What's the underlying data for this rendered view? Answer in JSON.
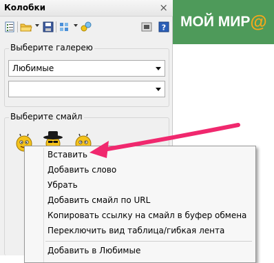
{
  "panel": {
    "title": "Колобки",
    "close_glyph": "×"
  },
  "toolbar": {
    "icons": [
      "properties-icon",
      "folder-icon",
      "save-icon",
      "view-icon",
      "smileys-icon",
      "settings-icon",
      "help-icon"
    ]
  },
  "gallery": {
    "label": "Выберите галерею",
    "selected": "Любимые",
    "subselected": ""
  },
  "smileys": {
    "label": "Выберите смайл"
  },
  "banner": {
    "text": "МОЙ МИР",
    "at": "@",
    "color": "#4e9a5a",
    "accent": "#f6a81b"
  },
  "context_menu": {
    "items": [
      {
        "label": "Вставить"
      },
      {
        "label": "Добавить слово"
      },
      {
        "label": "Убрать"
      },
      {
        "label": "Добавить смайл по URL"
      },
      {
        "label": "Копировать ссылку на смайл в буфер обмена"
      },
      {
        "label": "Переключить вид таблица/гибкая лента"
      },
      {
        "label": "Добавить в Любимые"
      }
    ]
  },
  "annotation": {
    "arrow_color": "#f0286e"
  }
}
